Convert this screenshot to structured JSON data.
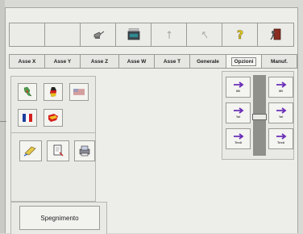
{
  "toolbar": {
    "buttons": [
      {
        "name": "blank-1",
        "icon": "none"
      },
      {
        "name": "blank-2",
        "icon": "none"
      },
      {
        "name": "oil-can",
        "icon": "oil-can-icon"
      },
      {
        "name": "display",
        "icon": "display-panel-icon"
      },
      {
        "name": "arrow-up",
        "icon": "arrow-up-icon"
      },
      {
        "name": "arrow-diag",
        "icon": "arrow-diagonal-icon"
      },
      {
        "name": "help",
        "icon": "question-mark-icon"
      },
      {
        "name": "exit",
        "icon": "exit-door-icon"
      }
    ]
  },
  "tabs": [
    {
      "label": "Asse X"
    },
    {
      "label": "Asse Y"
    },
    {
      "label": "Asse Z"
    },
    {
      "label": "Asse W"
    },
    {
      "label": "Asse T"
    },
    {
      "label": "Generale"
    },
    {
      "label": "Opzioni",
      "active": true
    },
    {
      "label": "Manuf."
    }
  ],
  "languages": [
    {
      "code": "it",
      "icon": "italy-flag-icon"
    },
    {
      "code": "de",
      "icon": "germany-flag-icon"
    },
    {
      "code": "us",
      "icon": "usa-flag-icon"
    },
    {
      "code": "fr",
      "icon": "france-flag-icon"
    },
    {
      "code": "es",
      "icon": "spain-flag-icon"
    }
  ],
  "tools": [
    {
      "icon": "pen-icon"
    },
    {
      "icon": "document-icon"
    },
    {
      "icon": "printer-icon"
    }
  ],
  "shutdown_label": "Spegnimento",
  "jog": {
    "left_labels": [
      "Mt",
      "'Ini",
      "Testi"
    ],
    "right_labels": [
      "Mt",
      "'Ini",
      "Testi"
    ],
    "arrow_color": "#6a2fb8"
  }
}
